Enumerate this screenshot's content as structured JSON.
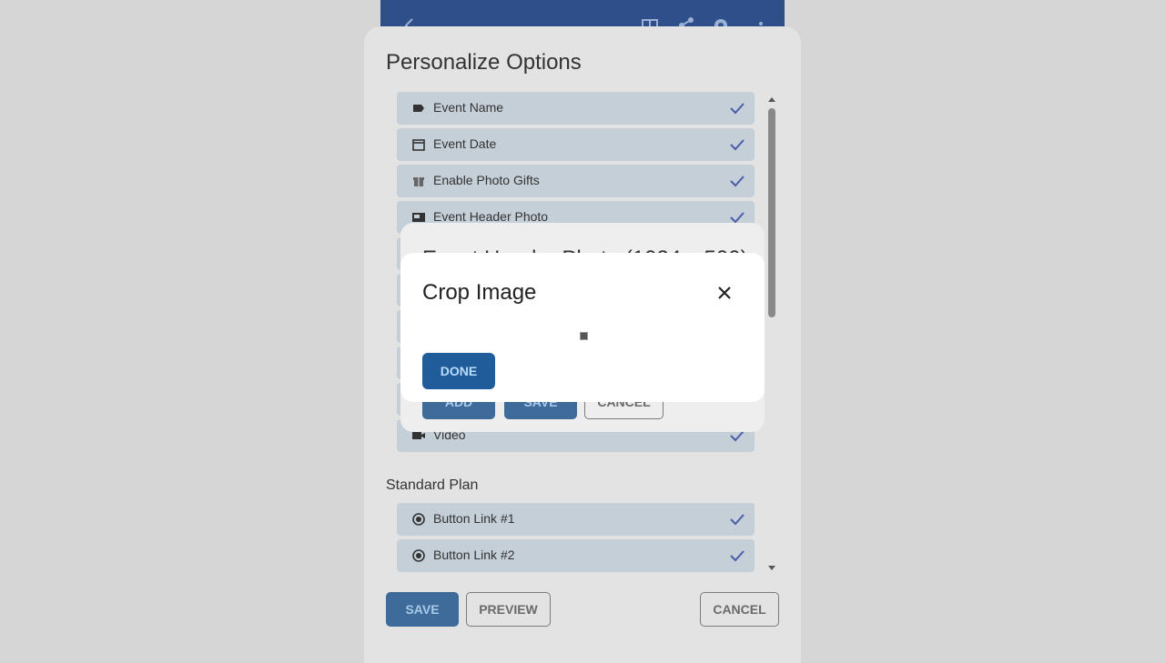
{
  "sheet": {
    "title": "Personalize Options",
    "options": [
      {
        "label": "Event Name",
        "icon": "tag-icon"
      },
      {
        "label": "Event Date",
        "icon": "calendar-icon"
      },
      {
        "label": "Enable Photo Gifts",
        "icon": "gift-icon"
      },
      {
        "label": "Event Header Photo",
        "icon": "image-icon"
      },
      {
        "label": "Video",
        "icon": "video-camera-icon"
      }
    ],
    "section_label": "Standard Plan",
    "plan_options": [
      {
        "label": "Button Link #1",
        "icon": "radio-icon"
      },
      {
        "label": "Button Link #2",
        "icon": "radio-icon"
      }
    ],
    "save_label": "SAVE",
    "preview_label": "PREVIEW",
    "cancel_label": "CANCEL"
  },
  "under_dialog": {
    "title": "Event Header Photo (1024 x 500)",
    "add_label": "ADD",
    "save_label": "SAVE",
    "cancel_label": "CANCEL"
  },
  "crop_dialog": {
    "title": "Crop Image",
    "done_label": "DONE"
  },
  "colors": {
    "header": "#2f4f8a",
    "option_bg": "#c5cfd8",
    "check": "#4a5ea8",
    "primary_button": "#3e6b99",
    "done_button": "#1f5c99"
  }
}
